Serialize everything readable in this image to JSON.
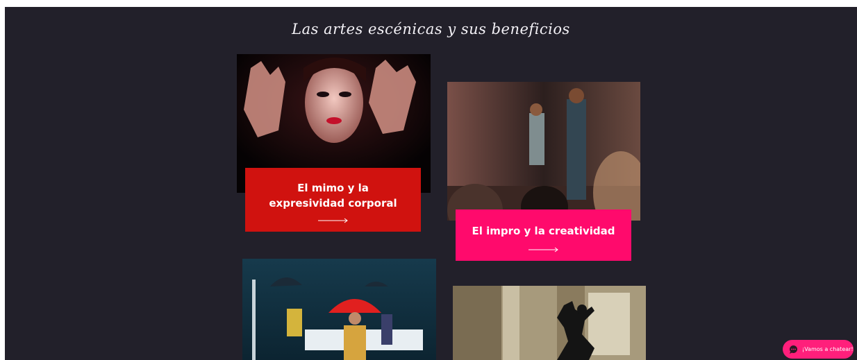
{
  "section": {
    "title": "Las artes escénicas y sus beneficios"
  },
  "cards": [
    {
      "title": "El mimo y la expresividad corporal",
      "color": "#d0120f",
      "arrow_icon": "long-arrow-right-icon"
    },
    {
      "title": "El impro y la creatividad",
      "color": "#ff0a6c",
      "arrow_icon": "long-arrow-right-icon"
    }
  ],
  "photos": [
    {
      "subject": "mime-face-hands"
    },
    {
      "subject": "improv-duo-on-stage"
    },
    {
      "subject": "stage-red-umbrella"
    },
    {
      "subject": "dancer-silhouette-window"
    }
  ],
  "chat": {
    "label": "¡Vamos a chatear!",
    "icon": "chat-bubble-icon",
    "color": "#ff1f7b"
  }
}
